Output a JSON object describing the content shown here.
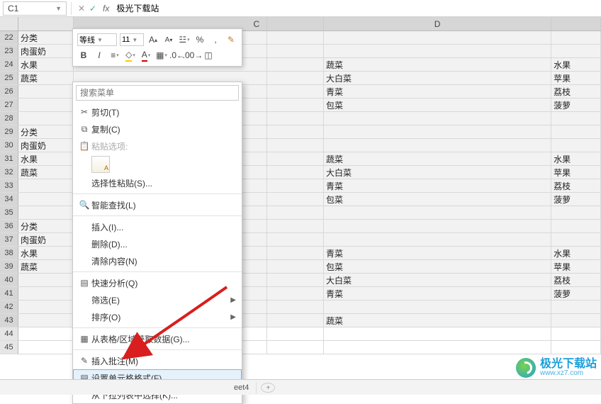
{
  "namebox": {
    "ref": "C1"
  },
  "formula_bar": {
    "value": "极光下载站",
    "fx": "fx"
  },
  "columns": {
    "c": "C",
    "d": "D"
  },
  "mini_toolbar": {
    "font_name": "等线",
    "font_size": "11",
    "btn_inc_font": "A",
    "btn_dec_font": "A",
    "btn_percent": "%",
    "btn_comma": ",",
    "btn_bold": "B",
    "btn_italic": "I",
    "btn_font_color": "A",
    "btn_fill_color": "◇"
  },
  "context_menu": {
    "search_placeholder": "搜索菜单",
    "cut": "剪切(T)",
    "copy": "复制(C)",
    "paste_options": "粘贴选项:",
    "paste_icon": "A",
    "paste_special": "选择性粘贴(S)...",
    "smart_lookup": "智能查找(L)",
    "insert": "插入(I)...",
    "delete": "删除(D)...",
    "clear": "清除内容(N)",
    "quick_analysis": "快速分析(Q)",
    "filter": "筛选(E)",
    "sort": "排序(O)",
    "table_data": "从表格/区域获取数据(G)...",
    "insert_comment": "插入批注(M)",
    "format_cells": "设置单元格格式(F)...",
    "from_dropdown": "从下拉列表中选择(K)..."
  },
  "rows": [
    {
      "n": 22,
      "a": "分类",
      "d": "",
      "e": ""
    },
    {
      "n": 23,
      "a": "肉蛋奶",
      "d": "",
      "e": ""
    },
    {
      "n": 24,
      "a": "水果",
      "d": "蔬菜",
      "e": "水果"
    },
    {
      "n": 25,
      "a": "蔬菜",
      "d": "大白菜",
      "e": "苹果"
    },
    {
      "n": 26,
      "a": "",
      "d": "青菜",
      "e": "荔枝"
    },
    {
      "n": 27,
      "a": "",
      "d": "包菜",
      "e": "菠萝"
    },
    {
      "n": 28,
      "a": "",
      "d": "",
      "e": ""
    },
    {
      "n": 29,
      "a": "分类",
      "d": "",
      "e": ""
    },
    {
      "n": 30,
      "a": "肉蛋奶",
      "d": "",
      "e": ""
    },
    {
      "n": 31,
      "a": "水果",
      "d": "蔬菜",
      "e": "水果"
    },
    {
      "n": 32,
      "a": "蔬菜",
      "d": "大白菜",
      "e": "苹果"
    },
    {
      "n": 33,
      "a": "",
      "d": "青菜",
      "e": "荔枝"
    },
    {
      "n": 34,
      "a": "",
      "d": "包菜",
      "e": "菠萝"
    },
    {
      "n": 35,
      "a": "",
      "d": "",
      "e": ""
    },
    {
      "n": 36,
      "a": "分类",
      "d": "",
      "e": ""
    },
    {
      "n": 37,
      "a": "肉蛋奶",
      "d": "",
      "e": ""
    },
    {
      "n": 38,
      "a": "水果",
      "d": "青菜",
      "e": "水果"
    },
    {
      "n": 39,
      "a": "蔬菜",
      "d": "包菜",
      "e": "苹果"
    },
    {
      "n": 40,
      "a": "",
      "d": "大白菜",
      "e": "荔枝"
    },
    {
      "n": 41,
      "a": "",
      "d": "青菜",
      "e": "菠萝"
    },
    {
      "n": 42,
      "a": "",
      "d": "",
      "e": ""
    },
    {
      "n": 43,
      "a": "",
      "d": "蔬菜",
      "e": ""
    },
    {
      "n": 44,
      "a": "",
      "d": "",
      "e": ""
    },
    {
      "n": 45,
      "a": "",
      "d": "",
      "e": ""
    }
  ],
  "selection_end": 43,
  "sheet_tabs": {
    "current": "eet4"
  },
  "watermark": {
    "brand": "极光下载站",
    "url": "www.xz7.com"
  }
}
